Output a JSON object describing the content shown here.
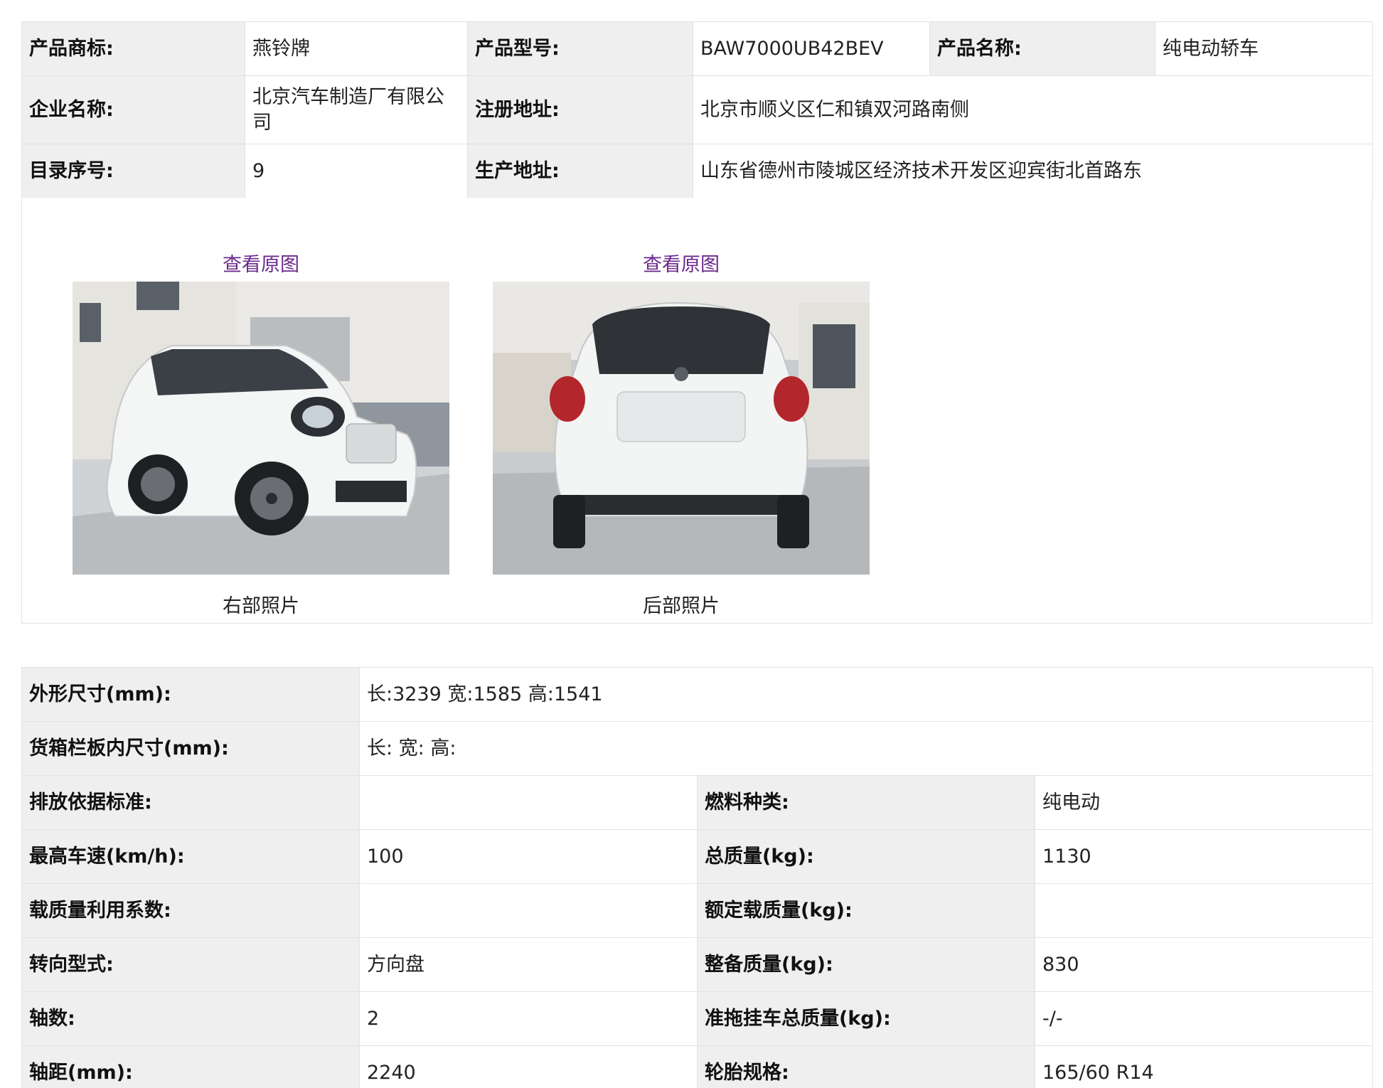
{
  "header": {
    "brand_label": "产品商标:",
    "brand_value": "燕铃牌",
    "model_label": "产品型号:",
    "model_value": "BAW7000UB42BEV",
    "product_name_label": "产品名称:",
    "product_name_value": "纯电动轿车",
    "company_label": "企业名称:",
    "company_value": "北京汽车制造厂有限公司",
    "reg_address_label": "注册地址:",
    "reg_address_value": "北京市顺义区仁和镇双河路南侧",
    "catalog_label": "目录序号:",
    "catalog_value": "9",
    "prod_address_label": "生产地址:",
    "prod_address_value": "山东省德州市陵城区经济技术开发区迎宾街北首路东"
  },
  "photos": [
    {
      "link": "查看原图",
      "caption": "右部照片"
    },
    {
      "link": "查看原图",
      "caption": "后部照片"
    }
  ],
  "specs": {
    "dims_label": "外形尺寸(mm):",
    "dims_value": "长:3239 宽:1585 高:1541",
    "cargo_label": "货箱栏板内尺寸(mm):",
    "cargo_value": "长: 宽: 高:",
    "emission_label": "排放依据标准:",
    "emission_value": "",
    "fuel_label": "燃料种类:",
    "fuel_value": "纯电动",
    "speed_label": "最高车速(km/h):",
    "speed_value": "100",
    "gross_mass_label": "总质量(kg):",
    "gross_mass_value": "1130",
    "load_coef_label": "载质量利用系数:",
    "load_coef_value": "",
    "rated_load_label": "额定载质量(kg):",
    "rated_load_value": "",
    "steering_label": "转向型式:",
    "steering_value": "方向盘",
    "curb_mass_label": "整备质量(kg):",
    "curb_mass_value": "830",
    "axles_label": "轴数:",
    "axles_value": "2",
    "trailer_label": "准拖挂车总质量(kg):",
    "trailer_value": "-/-",
    "wheelbase_label": "轴距(mm):",
    "wheelbase_value": "2240",
    "tire_label": "轮胎规格:",
    "tire_value": "165/60 R14"
  },
  "colors": {
    "label_bg": "#efefef",
    "border": "#e2e2e2",
    "link": "#6a2a8c"
  }
}
